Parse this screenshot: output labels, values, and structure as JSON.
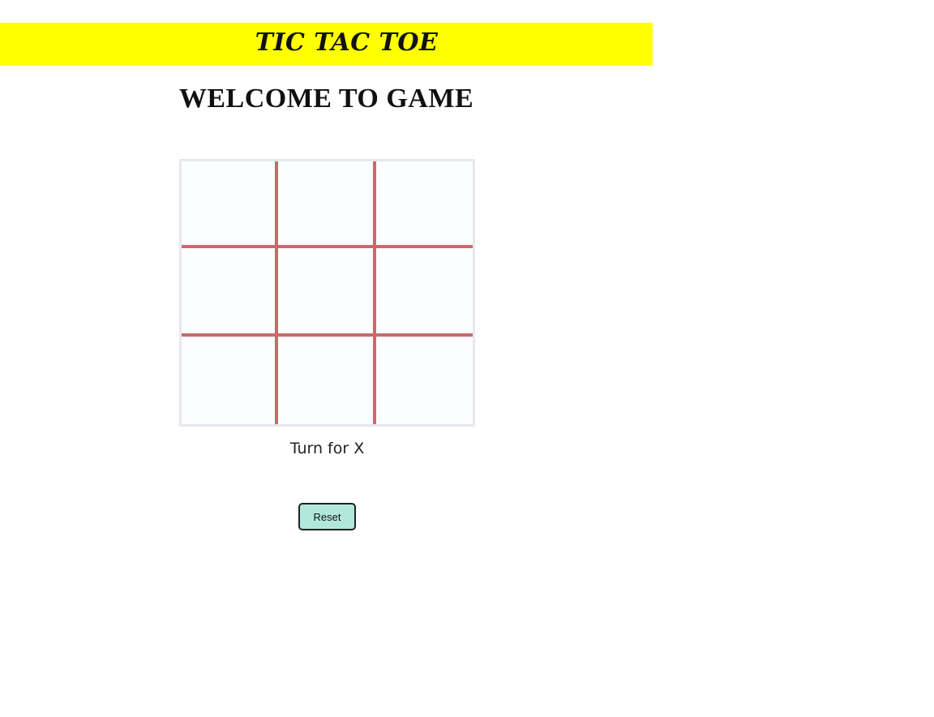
{
  "header": {
    "title": "TIC TAC TOE",
    "background_color": "#ffff00"
  },
  "main": {
    "welcome": "WELCOME TO GAME"
  },
  "board": {
    "line_color": "#c96a6a",
    "cells": [
      "",
      "",
      "",
      "",
      "",
      "",
      "",
      "",
      ""
    ]
  },
  "status": {
    "text": "Turn for X"
  },
  "controls": {
    "reset_label": "Reset",
    "reset_color": "#b2e8dc"
  }
}
